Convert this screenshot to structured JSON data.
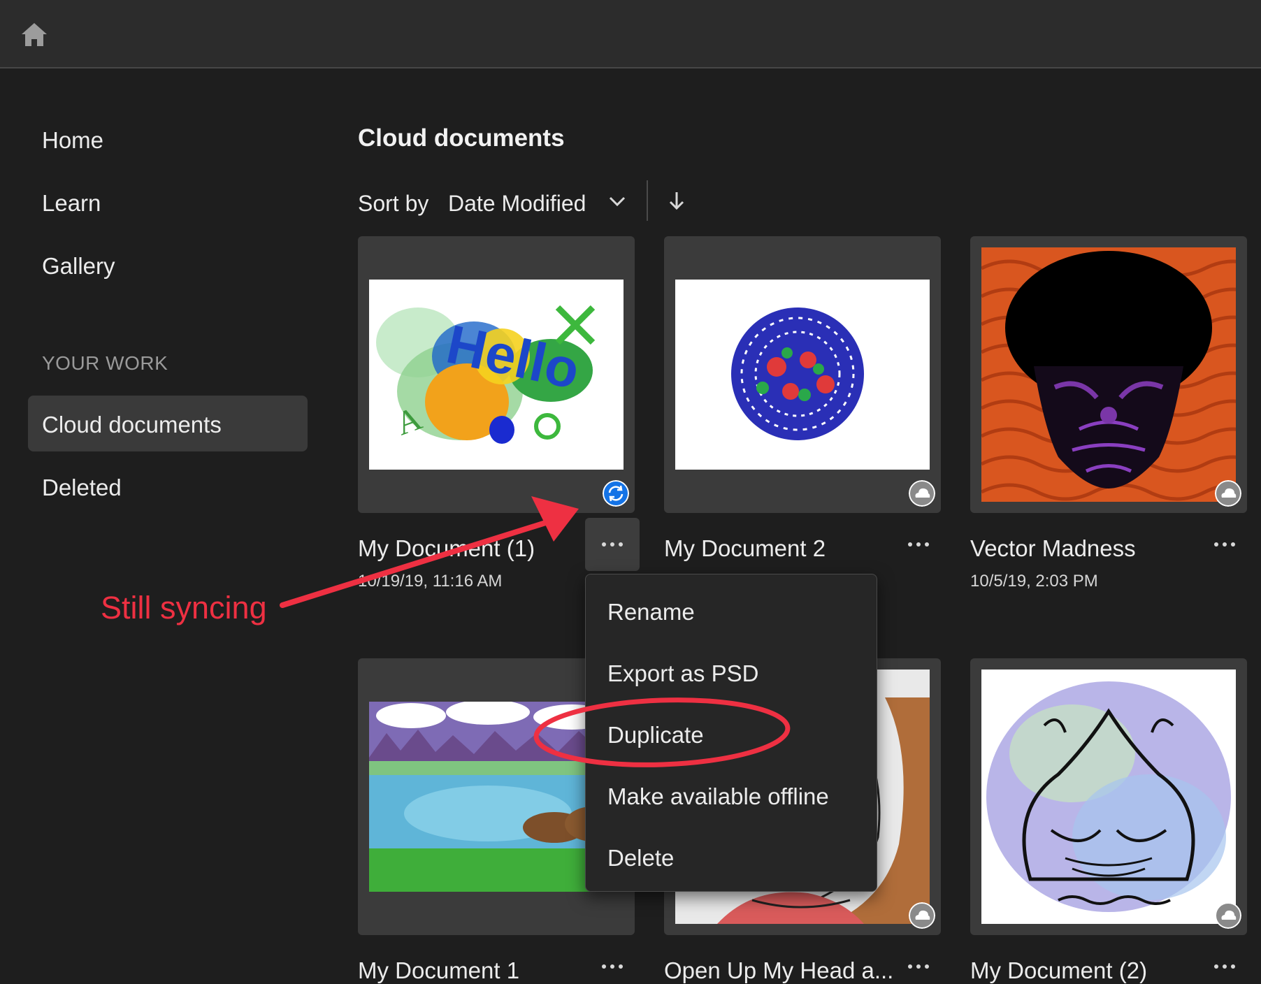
{
  "nav": {
    "home": "Home",
    "learn": "Learn",
    "gallery": "Gallery",
    "section": "YOUR WORK",
    "cloud": "Cloud documents",
    "deleted": "Deleted"
  },
  "page": {
    "title": "Cloud documents"
  },
  "sort": {
    "label": "Sort by",
    "value": "Date Modified"
  },
  "docs": [
    {
      "name": "My Document (1)",
      "date": "10/19/19, 11:16 AM",
      "status": "syncing"
    },
    {
      "name": "My Document 2",
      "date": "",
      "status": "cloud"
    },
    {
      "name": "Vector Madness",
      "date": "10/5/19, 2:03 PM",
      "status": "cloud"
    },
    {
      "name": "My Document 1",
      "date": "",
      "status": ""
    },
    {
      "name": "Open Up My Head a...",
      "date": "",
      "status": "cloud"
    },
    {
      "name": "My Document (2)",
      "date": "",
      "status": "cloud"
    }
  ],
  "menu": {
    "rename": "Rename",
    "export": "Export as PSD",
    "duplicate": "Duplicate",
    "offline": "Make available offline",
    "delete": "Delete"
  },
  "annotation": {
    "text": "Still syncing",
    "color": "#ee3042"
  },
  "icons": [
    "home-icon",
    "chevron-down-icon",
    "sort-direction-icon",
    "sync-icon",
    "cloud-icon",
    "more-icon"
  ],
  "colors": {
    "background": "#1e1e1e",
    "topbar": "#2c2c2c",
    "card": "#3b3b3b",
    "sync_blue": "#1473e6"
  }
}
